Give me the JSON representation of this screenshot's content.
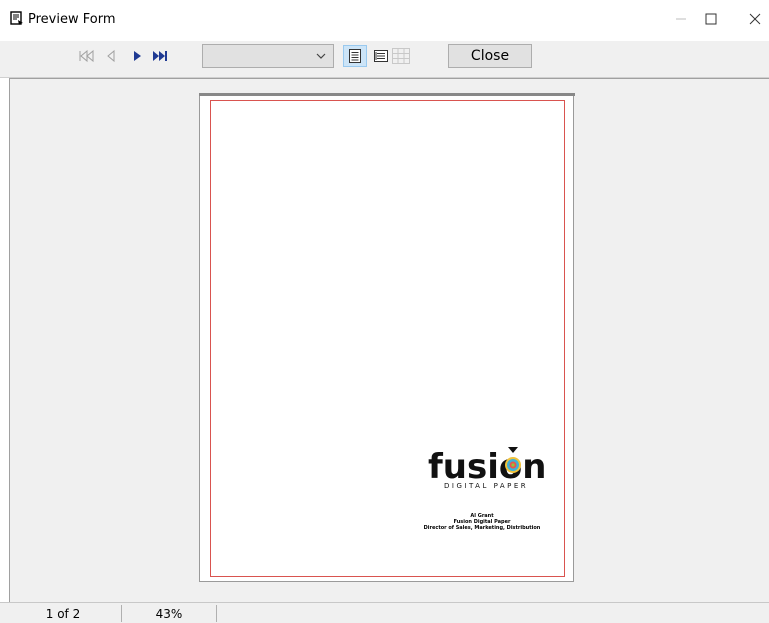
{
  "window": {
    "title": "Preview Form",
    "icon": "preview-form-icon"
  },
  "toolbar": {
    "first_icon": "first-page-icon",
    "prev_icon": "previous-page-icon",
    "next_icon": "next-page-icon",
    "last_icon": "last-page-icon",
    "page_select_value": "",
    "single_page_icon": "single-page-icon",
    "two_page_icon": "multi-page-icon",
    "grid_icon": "grid-icon",
    "close_label": "Close"
  },
  "document": {
    "logo_text_main": "fusion",
    "logo_text_sub": "DIGITAL PAPER",
    "signature": {
      "name": "Al Grant",
      "company": "Fusion Digital Paper",
      "title": "Director of Sales, Marketing, Distribution"
    }
  },
  "status": {
    "page_info": "1 of 2",
    "zoom": "43%"
  },
  "colors": {
    "accent_nav": "#1f3a93",
    "margin_border": "#d9534f"
  }
}
